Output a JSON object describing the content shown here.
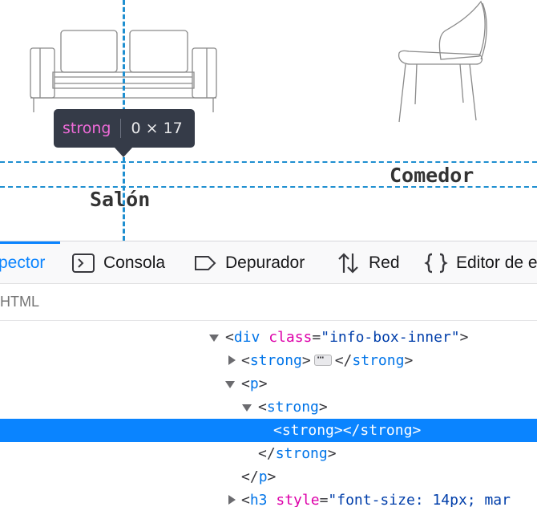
{
  "preview": {
    "infobar": {
      "tag": "strong",
      "dimensions": "0 × 17"
    },
    "labels": {
      "comedor": "Comedor",
      "salon": "Salón"
    }
  },
  "devtools": {
    "tabs": [
      {
        "label": "pector",
        "icon": "inspector-icon",
        "selected": true
      },
      {
        "label": "Consola",
        "icon": "console-icon",
        "selected": false
      },
      {
        "label": "Depurador",
        "icon": "debugger-icon",
        "selected": false
      },
      {
        "label": "Red",
        "icon": "network-icon",
        "selected": false
      },
      {
        "label": "Editor de e",
        "icon": "style-editor-icon",
        "selected": false
      }
    ],
    "breadcrumb": "HTML",
    "markup": {
      "l0": {
        "open": "<",
        "tag": "div",
        "attr": "class",
        "eq": "=",
        "value": "\"info-box-inner\"",
        "close": ">"
      },
      "l1": {
        "open": "<",
        "tag": "strong",
        "close": ">",
        "end_open": "</",
        "end_tag": "strong",
        "end_close": ">"
      },
      "l2": {
        "open": "<",
        "tag": "p",
        "close": ">"
      },
      "l3": {
        "open": "<",
        "tag": "strong",
        "close": ">"
      },
      "l4": {
        "open": "<",
        "tag": "strong",
        "close": ">",
        "end_open": "</",
        "end_tag": "strong",
        "end_close": ">"
      },
      "l5": {
        "end_open": "</",
        "end_tag": "strong",
        "end_close": ">"
      },
      "l6": {
        "end_open": "</",
        "end_tag": "p",
        "end_close": ">"
      },
      "l7": {
        "open": "<",
        "tag": "h3",
        "attr": "style",
        "eq": "=",
        "value": "\"font-size: 14px; mar"
      }
    }
  }
}
